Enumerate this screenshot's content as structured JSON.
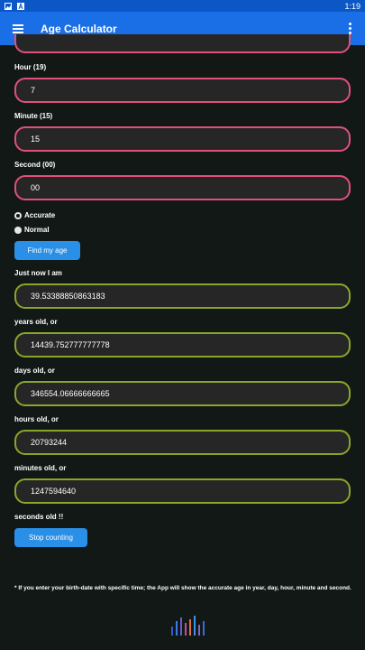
{
  "status_bar": {
    "time": "1:19"
  },
  "app_bar": {
    "title": "Age Calculator"
  },
  "inputs": {
    "hour": {
      "label": "Hour (19)",
      "value": "7"
    },
    "minute": {
      "label": "Minute (15)",
      "value": "15"
    },
    "second": {
      "label": "Second (00)",
      "value": "00"
    }
  },
  "mode": {
    "accurate_label": "Accurate",
    "normal_label": "Normal",
    "selected": "Accurate"
  },
  "buttons": {
    "find_label": "Find my age",
    "stop_label": "Stop counting"
  },
  "results": {
    "intro": "Just now I am",
    "years_value": "39.53388850863183",
    "years_label": "years old, or",
    "days_value": "14439.752777777778",
    "days_label": "days old, or",
    "hours_value": "346554.06666666665",
    "hours_label": "hours old, or",
    "minutes_value": "20793244",
    "minutes_label": "minutes old, or",
    "seconds_value": "1247594640",
    "seconds_label": "seconds old !!"
  },
  "footnote": "* If you enter your birth-date with specific time; the App will show the accurate age in year, day, hour, minute and second.",
  "colors": {
    "accent": "#1a6ee6",
    "input_border_pink": "#e0517a",
    "result_border_green": "#8aa62a",
    "button": "#2a8fe6"
  }
}
